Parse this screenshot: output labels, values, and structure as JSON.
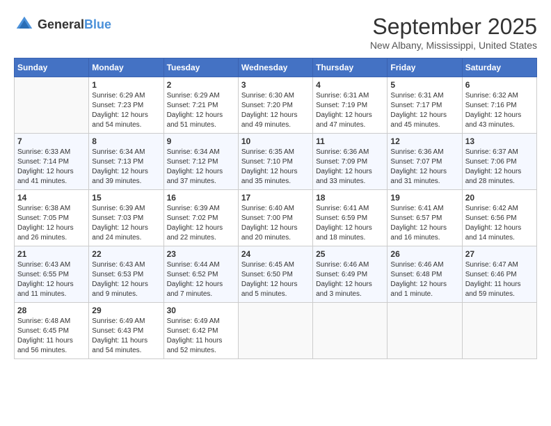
{
  "header": {
    "logo_general": "General",
    "logo_blue": "Blue",
    "month": "September 2025",
    "location": "New Albany, Mississippi, United States"
  },
  "days_of_week": [
    "Sunday",
    "Monday",
    "Tuesday",
    "Wednesday",
    "Thursday",
    "Friday",
    "Saturday"
  ],
  "weeks": [
    [
      {
        "day": "",
        "sunrise": "",
        "sunset": "",
        "daylight": ""
      },
      {
        "day": "1",
        "sunrise": "Sunrise: 6:29 AM",
        "sunset": "Sunset: 7:23 PM",
        "daylight": "Daylight: 12 hours and 54 minutes."
      },
      {
        "day": "2",
        "sunrise": "Sunrise: 6:29 AM",
        "sunset": "Sunset: 7:21 PM",
        "daylight": "Daylight: 12 hours and 51 minutes."
      },
      {
        "day": "3",
        "sunrise": "Sunrise: 6:30 AM",
        "sunset": "Sunset: 7:20 PM",
        "daylight": "Daylight: 12 hours and 49 minutes."
      },
      {
        "day": "4",
        "sunrise": "Sunrise: 6:31 AM",
        "sunset": "Sunset: 7:19 PM",
        "daylight": "Daylight: 12 hours and 47 minutes."
      },
      {
        "day": "5",
        "sunrise": "Sunrise: 6:31 AM",
        "sunset": "Sunset: 7:17 PM",
        "daylight": "Daylight: 12 hours and 45 minutes."
      },
      {
        "day": "6",
        "sunrise": "Sunrise: 6:32 AM",
        "sunset": "Sunset: 7:16 PM",
        "daylight": "Daylight: 12 hours and 43 minutes."
      }
    ],
    [
      {
        "day": "7",
        "sunrise": "Sunrise: 6:33 AM",
        "sunset": "Sunset: 7:14 PM",
        "daylight": "Daylight: 12 hours and 41 minutes."
      },
      {
        "day": "8",
        "sunrise": "Sunrise: 6:34 AM",
        "sunset": "Sunset: 7:13 PM",
        "daylight": "Daylight: 12 hours and 39 minutes."
      },
      {
        "day": "9",
        "sunrise": "Sunrise: 6:34 AM",
        "sunset": "Sunset: 7:12 PM",
        "daylight": "Daylight: 12 hours and 37 minutes."
      },
      {
        "day": "10",
        "sunrise": "Sunrise: 6:35 AM",
        "sunset": "Sunset: 7:10 PM",
        "daylight": "Daylight: 12 hours and 35 minutes."
      },
      {
        "day": "11",
        "sunrise": "Sunrise: 6:36 AM",
        "sunset": "Sunset: 7:09 PM",
        "daylight": "Daylight: 12 hours and 33 minutes."
      },
      {
        "day": "12",
        "sunrise": "Sunrise: 6:36 AM",
        "sunset": "Sunset: 7:07 PM",
        "daylight": "Daylight: 12 hours and 31 minutes."
      },
      {
        "day": "13",
        "sunrise": "Sunrise: 6:37 AM",
        "sunset": "Sunset: 7:06 PM",
        "daylight": "Daylight: 12 hours and 28 minutes."
      }
    ],
    [
      {
        "day": "14",
        "sunrise": "Sunrise: 6:38 AM",
        "sunset": "Sunset: 7:05 PM",
        "daylight": "Daylight: 12 hours and 26 minutes."
      },
      {
        "day": "15",
        "sunrise": "Sunrise: 6:39 AM",
        "sunset": "Sunset: 7:03 PM",
        "daylight": "Daylight: 12 hours and 24 minutes."
      },
      {
        "day": "16",
        "sunrise": "Sunrise: 6:39 AM",
        "sunset": "Sunset: 7:02 PM",
        "daylight": "Daylight: 12 hours and 22 minutes."
      },
      {
        "day": "17",
        "sunrise": "Sunrise: 6:40 AM",
        "sunset": "Sunset: 7:00 PM",
        "daylight": "Daylight: 12 hours and 20 minutes."
      },
      {
        "day": "18",
        "sunrise": "Sunrise: 6:41 AM",
        "sunset": "Sunset: 6:59 PM",
        "daylight": "Daylight: 12 hours and 18 minutes."
      },
      {
        "day": "19",
        "sunrise": "Sunrise: 6:41 AM",
        "sunset": "Sunset: 6:57 PM",
        "daylight": "Daylight: 12 hours and 16 minutes."
      },
      {
        "day": "20",
        "sunrise": "Sunrise: 6:42 AM",
        "sunset": "Sunset: 6:56 PM",
        "daylight": "Daylight: 12 hours and 14 minutes."
      }
    ],
    [
      {
        "day": "21",
        "sunrise": "Sunrise: 6:43 AM",
        "sunset": "Sunset: 6:55 PM",
        "daylight": "Daylight: 12 hours and 11 minutes."
      },
      {
        "day": "22",
        "sunrise": "Sunrise: 6:43 AM",
        "sunset": "Sunset: 6:53 PM",
        "daylight": "Daylight: 12 hours and 9 minutes."
      },
      {
        "day": "23",
        "sunrise": "Sunrise: 6:44 AM",
        "sunset": "Sunset: 6:52 PM",
        "daylight": "Daylight: 12 hours and 7 minutes."
      },
      {
        "day": "24",
        "sunrise": "Sunrise: 6:45 AM",
        "sunset": "Sunset: 6:50 PM",
        "daylight": "Daylight: 12 hours and 5 minutes."
      },
      {
        "day": "25",
        "sunrise": "Sunrise: 6:46 AM",
        "sunset": "Sunset: 6:49 PM",
        "daylight": "Daylight: 12 hours and 3 minutes."
      },
      {
        "day": "26",
        "sunrise": "Sunrise: 6:46 AM",
        "sunset": "Sunset: 6:48 PM",
        "daylight": "Daylight: 12 hours and 1 minute."
      },
      {
        "day": "27",
        "sunrise": "Sunrise: 6:47 AM",
        "sunset": "Sunset: 6:46 PM",
        "daylight": "Daylight: 11 hours and 59 minutes."
      }
    ],
    [
      {
        "day": "28",
        "sunrise": "Sunrise: 6:48 AM",
        "sunset": "Sunset: 6:45 PM",
        "daylight": "Daylight: 11 hours and 56 minutes."
      },
      {
        "day": "29",
        "sunrise": "Sunrise: 6:49 AM",
        "sunset": "Sunset: 6:43 PM",
        "daylight": "Daylight: 11 hours and 54 minutes."
      },
      {
        "day": "30",
        "sunrise": "Sunrise: 6:49 AM",
        "sunset": "Sunset: 6:42 PM",
        "daylight": "Daylight: 11 hours and 52 minutes."
      },
      {
        "day": "",
        "sunrise": "",
        "sunset": "",
        "daylight": ""
      },
      {
        "day": "",
        "sunrise": "",
        "sunset": "",
        "daylight": ""
      },
      {
        "day": "",
        "sunrise": "",
        "sunset": "",
        "daylight": ""
      },
      {
        "day": "",
        "sunrise": "",
        "sunset": "",
        "daylight": ""
      }
    ]
  ]
}
